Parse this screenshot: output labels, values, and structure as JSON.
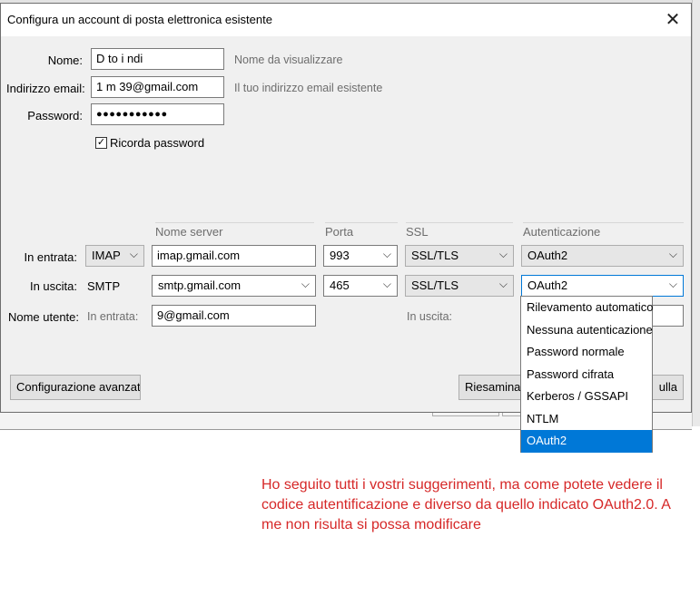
{
  "dialog": {
    "title": "Configura un account di posta elettronica esistente",
    "close_glyph": "✕"
  },
  "identity": {
    "name_label": "Nome:",
    "name_value": "D   to   i  ndi",
    "name_hint": "Nome da visualizzare",
    "email_label": "Indirizzo email:",
    "email_value": "1   m    39@gmail.com",
    "email_hint": "Il tuo indirizzo email esistente",
    "password_label": "Password:",
    "password_value": "●●●●●●●●●●●",
    "remember_label": "Ricorda password",
    "remember_checked": "✓"
  },
  "servers": {
    "headers": {
      "server": "Nome server",
      "port": "Porta",
      "ssl": "SSL",
      "auth": "Autenticazione"
    },
    "incoming": {
      "label": "In entrata:",
      "protocol": "IMAP",
      "server": "imap.gmail.com",
      "port": "993",
      "ssl": "SSL/TLS",
      "auth": "OAuth2"
    },
    "outgoing": {
      "label": "In uscita:",
      "protocol": "SMTP",
      "server": "smtp.gmail.com",
      "port": "465",
      "ssl": "SSL/TLS",
      "auth": "OAuth2"
    },
    "username": {
      "label": "Nome utente:",
      "incoming_label": "In entrata:",
      "incoming_value": "           9@gmail.com",
      "outgoing_label": "In uscita:"
    }
  },
  "auth_dropdown": {
    "options": [
      "Rilevamento automatico",
      "Nessuna autenticazione",
      "Password normale",
      "Password cifrata",
      "Kerberos / GSSAPI",
      "NTLM",
      "OAuth2"
    ],
    "selected": "OAuth2"
  },
  "buttons": {
    "advanced": "Configurazione avanzata",
    "retest": "Riesaminare",
    "cancel": "ulla"
  },
  "note": {
    "text": "Ho seguito tutti i vostri  suggerimenti, ma come potete vedere il codice autentificazione e diverso da quello indicato OAuth2.0. A me non risulta si possa modificare"
  },
  "chevron_glyph": "⌵",
  "colors": {
    "accent": "#0078d7",
    "note": "#d62828",
    "dialog_bg": "#f0f0f0"
  }
}
